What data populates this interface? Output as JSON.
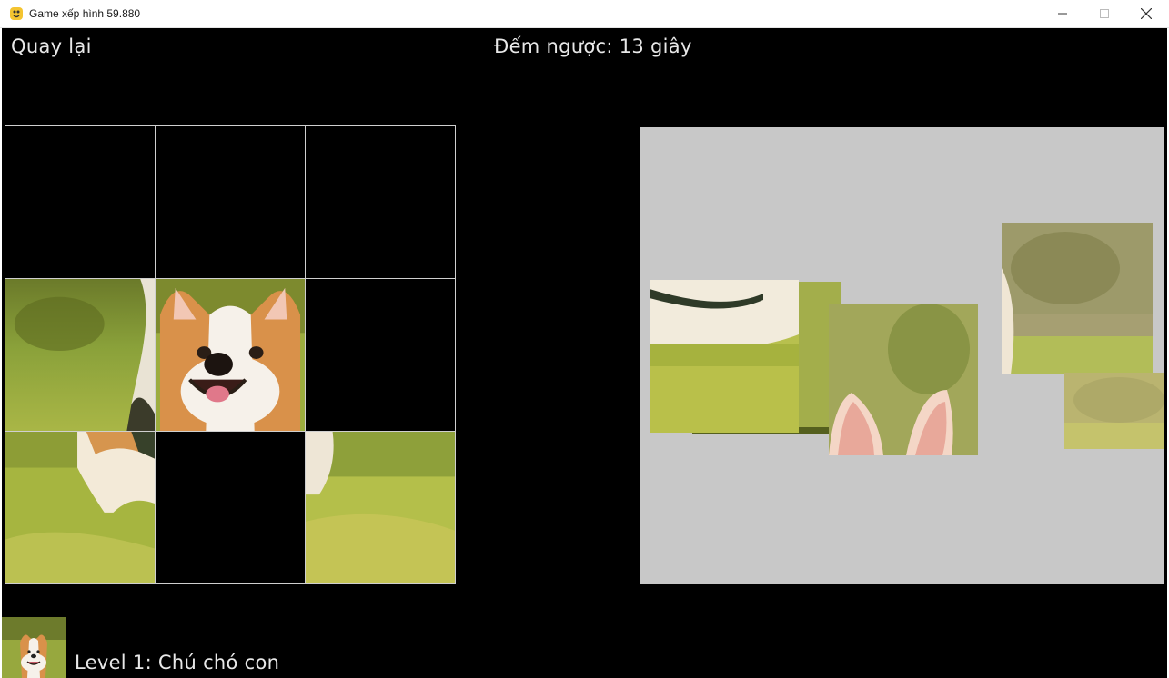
{
  "window": {
    "title": "Game xếp hình 59.880",
    "icon": "python-icon",
    "controls": [
      "minimize-icon",
      "maximize-icon",
      "close-icon"
    ]
  },
  "header": {
    "back_label": "Quay lại",
    "countdown_label": "Đếm ngược: 13 giây"
  },
  "board": {
    "rows": 3,
    "cols": 3,
    "cells": [
      {
        "row": 0,
        "col": 0,
        "filled": false
      },
      {
        "row": 0,
        "col": 1,
        "filled": false
      },
      {
        "row": 0,
        "col": 2,
        "filled": false
      },
      {
        "row": 1,
        "col": 0,
        "filled": true,
        "piece": "grass-background-left"
      },
      {
        "row": 1,
        "col": 1,
        "filled": true,
        "piece": "corgi-face"
      },
      {
        "row": 1,
        "col": 2,
        "filled": false
      },
      {
        "row": 2,
        "col": 0,
        "filled": true,
        "piece": "corgi-body-left"
      },
      {
        "row": 2,
        "col": 1,
        "filled": false
      },
      {
        "row": 2,
        "col": 2,
        "filled": true,
        "piece": "grass-right"
      }
    ]
  },
  "tray": {
    "background": "#c8c8c8",
    "pieces": [
      {
        "piece": "corgi-ears"
      },
      {
        "piece": "corgi-collar-grass"
      },
      {
        "piece": "blurred-field-left"
      },
      {
        "piece": "blurred-field-right"
      },
      {
        "piece": "grass-strip"
      }
    ]
  },
  "footer": {
    "level_label": "Level 1: Chú chó con",
    "thumbnail": "corgi-thumbnail"
  },
  "colors": {
    "game_background": "#000000",
    "text": "#e8e8e8",
    "grid_line": "#cfcfcf",
    "tray": "#c8c8c8"
  }
}
